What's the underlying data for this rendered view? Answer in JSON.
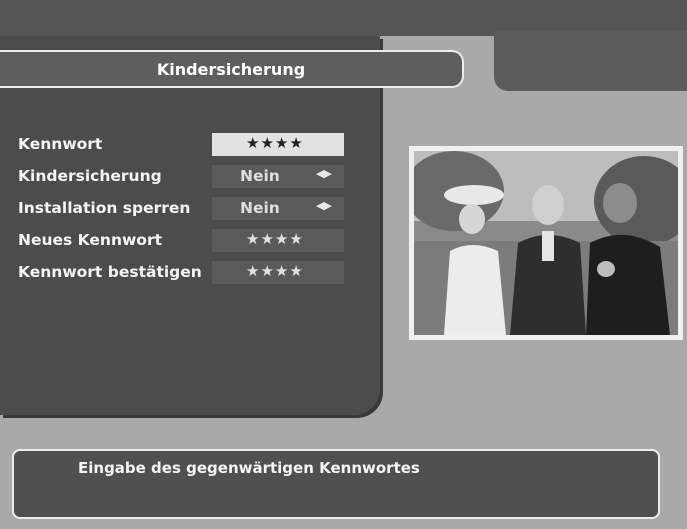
{
  "header": {
    "title": "Kindersicherung"
  },
  "menu": {
    "items": [
      {
        "label": "Kennwort",
        "stars": "★★★★"
      },
      {
        "label": "Kindersicherung",
        "value": "Nein",
        "arrows": "◀▶"
      },
      {
        "label": "Installation sperren",
        "value": "Nein",
        "arrows": "◀▶"
      },
      {
        "label": "Neues Kennwort",
        "stars": "★★★★"
      },
      {
        "label": "Kennwort bestätigen",
        "stars": "★★★★"
      }
    ]
  },
  "info": {
    "text": "Eingabe des gegenwärtigen Kennwortes"
  }
}
